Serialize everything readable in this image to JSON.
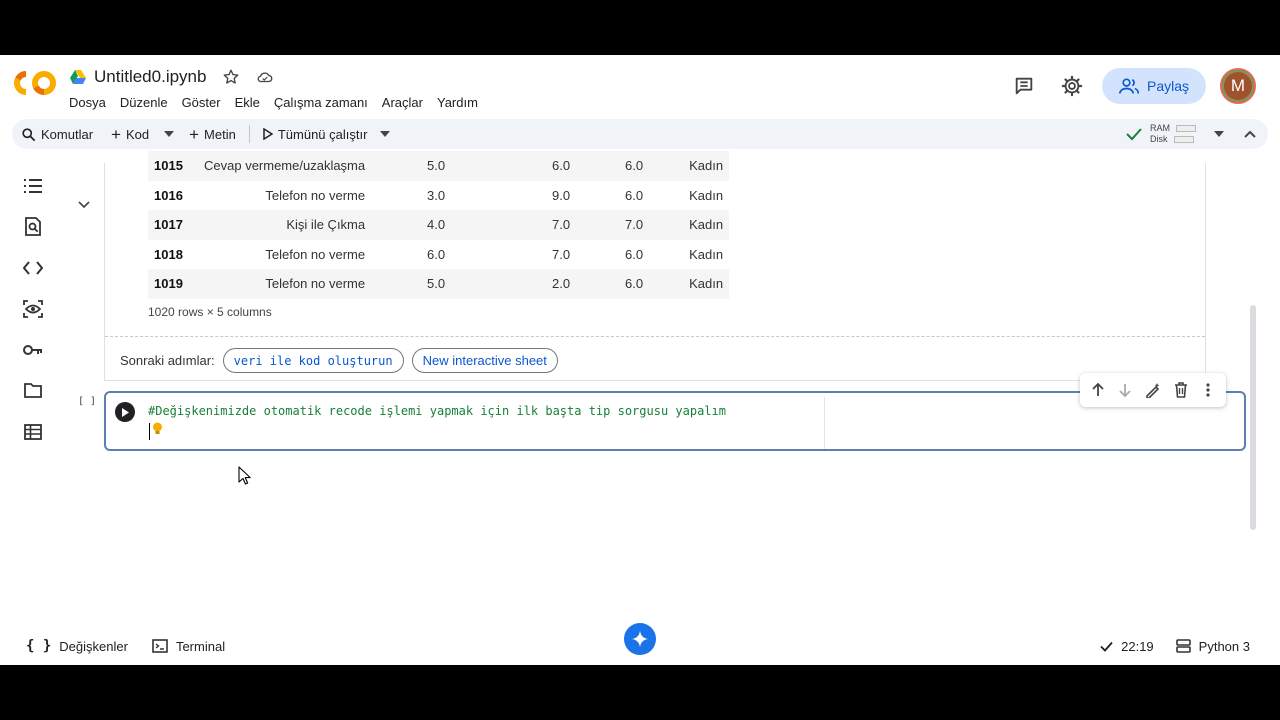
{
  "header": {
    "doc_title": "Untitled0.ipynb",
    "menu": [
      "Dosya",
      "Düzenle",
      "Göster",
      "Ekle",
      "Çalışma zamanı",
      "Araçlar",
      "Yardım"
    ],
    "share_label": "Paylaş",
    "avatar_letter": "M"
  },
  "toolbar": {
    "commands_label": "Komutlar",
    "code_label": "Kod",
    "text_label": "Metin",
    "run_all_label": "Tümünü çalıştır",
    "ram_label": "RAM",
    "disk_label": "Disk"
  },
  "output": {
    "rows": [
      {
        "idx": "1015",
        "c1": "Cevap vermeme/uzaklaşma",
        "c2": "5.0",
        "c3": "6.0",
        "c4": "6.0",
        "c5": "Kadın"
      },
      {
        "idx": "1016",
        "c1": "Telefon no verme",
        "c2": "3.0",
        "c3": "9.0",
        "c4": "6.0",
        "c5": "Kadın"
      },
      {
        "idx": "1017",
        "c1": "Kişi ile Çıkma",
        "c2": "4.0",
        "c3": "7.0",
        "c4": "7.0",
        "c5": "Kadın"
      },
      {
        "idx": "1018",
        "c1": "Telefon no verme",
        "c2": "6.0",
        "c3": "7.0",
        "c4": "6.0",
        "c5": "Kadın"
      },
      {
        "idx": "1019",
        "c1": "Telefon no verme",
        "c2": "5.0",
        "c3": "2.0",
        "c4": "6.0",
        "c5": "Kadın"
      }
    ],
    "footer": "1020 rows × 5 columns",
    "next_steps_label": "Sonraki adımlar:",
    "chip_generate": "veri ile kod oluşturun",
    "chip_sheet": "New interactive sheet"
  },
  "code_cell": {
    "exec_count": "[ ]",
    "code": "#Değişkenimizde otomatik recode işlemi yapmak için ilk başta tip sorgusu yapalım"
  },
  "status": {
    "variables_label": "Değişkenler",
    "terminal_label": "Terminal",
    "time": "22:19",
    "kernel": "Python 3"
  },
  "colors": {
    "accent": "#0b57d0",
    "share_bg": "#d3e3fd",
    "code_comment": "#188038",
    "logo_orange": "#f9ab00",
    "logo_dark": "#e8710a"
  }
}
